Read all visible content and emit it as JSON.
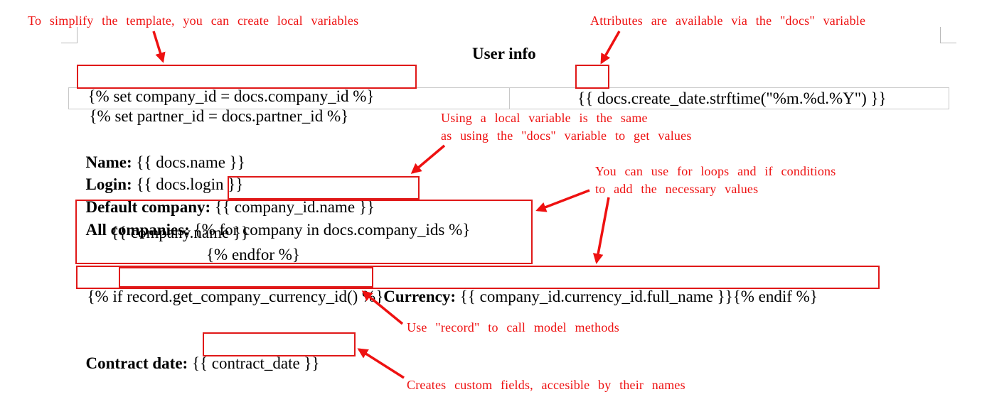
{
  "annotation_color": "#ee1111",
  "document": {
    "title": "User info",
    "set_company": "{% set company_id = docs.company_id %}",
    "set_partner_prefix": "{% set partner_id = ",
    "set_partner_docs": "docs.",
    "set_partner_suffix": "partner_id %}",
    "create_date": "{{ docs.create_date.strftime(\"%m.%d.%Y\") }}",
    "name_label": "Name:",
    "name_value": "{{ docs.name }}",
    "login_label": "Login:",
    "login_value": "{{ docs.login }}",
    "default_company_label": "Default company:",
    "default_company_value": "{{ company_id.name }}",
    "all_companies_label": "All companies:",
    "all_companies_loop": "{% for company in docs.company_ids %}",
    "company_name": "{{ company.name }}",
    "endfor": "{% endfor %}",
    "if_prefix": "{% if ",
    "if_method": "record.get_company_currency_id()",
    "if_suffix": " %}",
    "currency_label": "Currency:",
    "currency_value": " {{ company_id.currency_id.full_name }}{% endif %}",
    "contract_label": "Contract date:",
    "contract_value": "{{ contract_date }}"
  },
  "annotations": {
    "local_variables": "To simplify the template, you can create local variables",
    "docs_variable": "Attributes are available via the \"docs\" variable",
    "local_same_line1": "Using a local variable is the same",
    "local_same_line2": "as using the \"docs\" variable to get values",
    "loops_line1": "You can use for loops and if conditions",
    "loops_line2": "to add the necessary values",
    "record_methods": "Use \"record\" to call model methods",
    "custom_fields": "Creates custom fields, accesible by their names"
  }
}
